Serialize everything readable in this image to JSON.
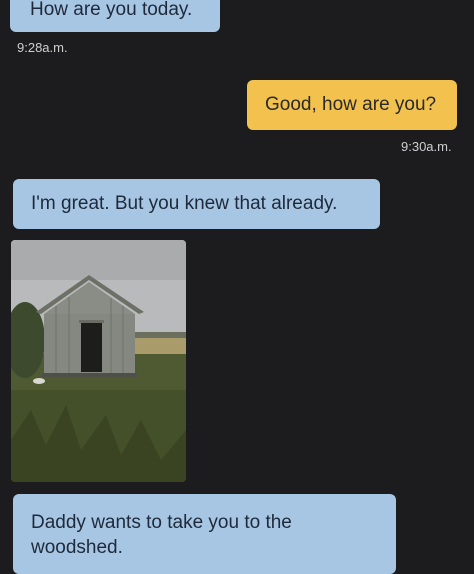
{
  "messages": [
    {
      "from": "them",
      "text": "How are you today."
    },
    {
      "from": "me",
      "text": "Good, how are you?"
    },
    {
      "from": "them",
      "text": "I'm great. But you knew that already."
    },
    {
      "from": "them",
      "text": "Daddy wants to take you to the woodshed."
    }
  ],
  "timestamps": [
    "9:28a.m.",
    "9:30a.m."
  ],
  "photo": {
    "subject": "shed"
  },
  "colors": {
    "background": "#1c1c1e",
    "incoming_bubble": "#a7c6e4",
    "outgoing_bubble": "#f2c14e"
  }
}
